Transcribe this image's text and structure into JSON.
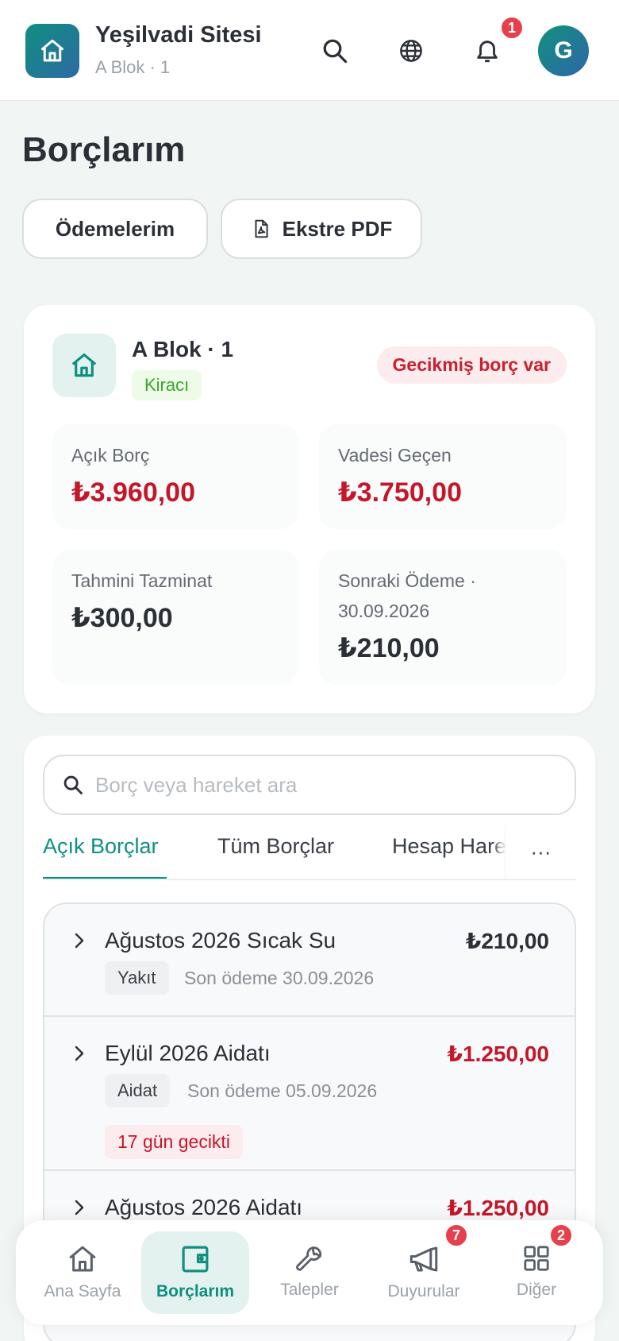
{
  "header": {
    "site_name": "Yeşilvadi Sitesi",
    "unit": "A Blok · 1",
    "notification_count": "1",
    "avatar_initial": "G"
  },
  "page": {
    "title": "Borçlarım",
    "payments_button": "Ödemelerim",
    "statement_button": "Ekstre PDF"
  },
  "summary": {
    "unit_name": "A Blok · 1",
    "role": "Kiracı",
    "overdue_badge": "Gecikmiş borç var",
    "stats": [
      {
        "label": "Açık Borç",
        "value": "₺3.960,00"
      },
      {
        "label": "Vadesi Geçen",
        "value": "₺3.750,00"
      },
      {
        "label": "Tahmini Tazminat",
        "value": "₺300,00"
      },
      {
        "label": "Sonraki Ödeme · 30.09.2026",
        "value": "₺210,00"
      }
    ]
  },
  "search": {
    "placeholder": "Borç veya hareket ara"
  },
  "tabs": [
    {
      "label": "Açık Borçlar"
    },
    {
      "label": "Tüm Borçlar"
    },
    {
      "label": "Hesap Hareketleri"
    }
  ],
  "tabs_more": "···",
  "debts": [
    {
      "title": "Ağustos 2026 Sıcak Su",
      "amount": "₺210,00",
      "category": "Yakıt",
      "due": "Son ödeme 30.09.2026",
      "late": ""
    },
    {
      "title": "Eylül 2026 Aidatı",
      "amount": "₺1.250,00",
      "category": "Aidat",
      "due": "Son ödeme 05.09.2026",
      "late": "17 gün gecikti"
    },
    {
      "title": "Ağustos 2026 Aidatı",
      "amount": "₺1.250,00",
      "category": "",
      "due": "",
      "late": ""
    }
  ],
  "bottom_nav": [
    {
      "label": "Ana Sayfa",
      "icon": "home-icon"
    },
    {
      "label": "Borçlarım",
      "icon": "wallet-icon"
    },
    {
      "label": "Talepler",
      "icon": "wrench-icon"
    },
    {
      "label": "Duyurular",
      "icon": "megaphone-icon",
      "badge": "7"
    },
    {
      "label": "Diğer",
      "icon": "grid-icon",
      "badge": "2"
    }
  ],
  "colors": {
    "accent": "#0f8f80",
    "danger": "#c3172a",
    "badge": "#e5404c"
  }
}
